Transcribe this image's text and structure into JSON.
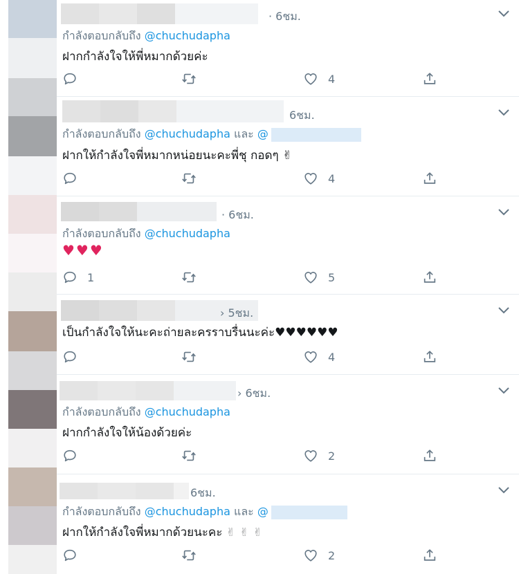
{
  "colors": {
    "link": "#1b95e0",
    "muted": "#657786",
    "heart": "#e0245e",
    "text": "#14171a"
  },
  "icons": {
    "reply": "reply-icon",
    "retweet": "retweet-icon",
    "like": "heart-icon",
    "share": "share-icon",
    "menu": "chevron-down-icon"
  },
  "tweets": [
    {
      "time": "· 6ชม.",
      "reply_prefix": "กำลังตอบกลับถึง",
      "mention": "@chuchudapha",
      "text": "ฝากกำลังใจให้พี่หมากด้วยค่ะ",
      "reply_count": "",
      "retweet_count": "",
      "like_count": "4"
    },
    {
      "time": "6ชม.",
      "reply_prefix": "กำลังตอบกลับถึง",
      "mention": "@chuchudapha",
      "conj": "และ",
      "mention2": "@",
      "text": "ฝากให้กำลังใจพี่หมากหน่อยนะคะพี่ชุ กอดๆ ✌",
      "reply_count": "",
      "retweet_count": "",
      "like_count": "4"
    },
    {
      "time": "· 6ชม.",
      "reply_prefix": "กำลังตอบกลับถึง",
      "mention": "@chuchudapha",
      "text": "♥♥♥",
      "reply_count": "1",
      "retweet_count": "",
      "like_count": "5"
    },
    {
      "time": "› 5ชม.",
      "text": "เป็นกำลังใจให้นะคะถ่ายละครราบรื่นนะค่ะ♥♥♥♥♥♥",
      "reply_count": "",
      "retweet_count": "",
      "like_count": "4"
    },
    {
      "time": "› 6ชม.",
      "reply_prefix": "กำลังตอบกลับถึง",
      "mention": "@chuchudapha",
      "text": "ฝากกำลังใจให้น้องด้วยค่ะ",
      "reply_count": "",
      "retweet_count": "",
      "like_count": "2"
    },
    {
      "time": "6ชม.",
      "reply_prefix": "กำลังตอบกลับถึง",
      "mention": "@chuchudapha",
      "conj": "และ",
      "mention2": "@",
      "text": "ฝากให้กำลังใจพี่หมากด้วยนะคะ",
      "emoji": "✌✌✌",
      "reply_count": "",
      "retweet_count": "",
      "like_count": "2"
    }
  ]
}
